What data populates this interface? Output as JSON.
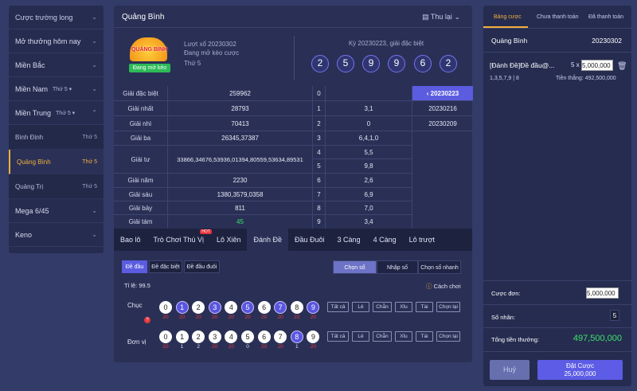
{
  "sidebar": {
    "items": [
      {
        "label": "Cược trường long"
      },
      {
        "label": "Mở thưởng hôm nay"
      },
      {
        "label": "Miền Bắc"
      },
      {
        "label": "Miền Nam",
        "day": "Thứ 5"
      },
      {
        "label": "Miền Trung",
        "day": "Thứ 5"
      }
    ],
    "sub_items": [
      {
        "label": "Bình Định",
        "day": "Thứ 5"
      },
      {
        "label": "Quảng Bình",
        "day": "Thứ 5"
      },
      {
        "label": "Quảng Trị",
        "day": "Thứ 5"
      }
    ],
    "bottom": [
      {
        "label": "Mega 6/45"
      },
      {
        "label": "Keno"
      }
    ]
  },
  "main": {
    "title": "Quảng Bình",
    "thu_lai": "Thu lại",
    "logo_name": "QUẢNG BÌNH",
    "logo_badge": "Đang mở kèo",
    "luot_xo": "Lượt xổ 20230302",
    "dang_mo": "Đang mở kèo cược",
    "thu": "Thứ 5",
    "ky": "Kỳ 20230223, giải đặc biệt",
    "balls": [
      "2",
      "5",
      "9",
      "9",
      "6",
      "2"
    ]
  },
  "results": [
    {
      "name": "Giải đặc biệt",
      "value": "259962"
    },
    {
      "name": "Giải nhất",
      "value": "28793"
    },
    {
      "name": "Giải nhì",
      "value": "70413"
    },
    {
      "name": "Giải ba",
      "value": "26345,37387"
    },
    {
      "name": "Giải tư",
      "value": "33866,34676,53936,01394,80559,53634,89531"
    },
    {
      "name": "Giải năm",
      "value": "2230"
    },
    {
      "name": "Giải sáu",
      "value": "1380,3579,0358"
    },
    {
      "name": "Giải bảy",
      "value": "811"
    },
    {
      "name": "Giải tám",
      "value": "45"
    }
  ],
  "dauduoi": [
    {
      "h": "0",
      "v": ""
    },
    {
      "h": "1",
      "v": "3,1"
    },
    {
      "h": "2",
      "v": "0"
    },
    {
      "h": "3",
      "v": "6,4,1,0"
    },
    {
      "h": "4",
      "v": "5,5"
    },
    {
      "h": "5",
      "v": "9,8"
    },
    {
      "h": "6",
      "v": "2,6"
    },
    {
      "h": "7",
      "v": "6,9"
    },
    {
      "h": "8",
      "v": "7,0"
    },
    {
      "h": "9",
      "v": "3,4"
    }
  ],
  "dates": [
    "20230223",
    "20230216",
    "20230209"
  ],
  "tabs": [
    {
      "label": "Bao lô"
    },
    {
      "label": "Trò Chơi Thú Vị",
      "hot": "HOT"
    },
    {
      "label": "Lô Xiên"
    },
    {
      "label": "Đánh Đề"
    },
    {
      "label": "Đầu Đuôi"
    },
    {
      "label": "3 Càng"
    },
    {
      "label": "4 Càng"
    },
    {
      "label": "Lô trượt"
    }
  ],
  "bet_types": [
    "Đề đầu",
    "Đề đặc biệt",
    "Đề đầu đuôi"
  ],
  "modes": [
    "Chọn số",
    "Nhập số",
    "Chọn số nhanh"
  ],
  "ti_le": "Tỉ lệ:  99.5",
  "cach_choi": "Cách chơi",
  "chuc": {
    "label": "Chục",
    "numbers": [
      "0",
      "1",
      "2",
      "3",
      "4",
      "5",
      "6",
      "7",
      "8",
      "9"
    ],
    "counts": [
      "20",
      "20",
      "20",
      "20",
      "20",
      "20",
      "20",
      "20",
      "20",
      "20"
    ]
  },
  "don_vi": {
    "label": "Đơn vị",
    "numbers": [
      "0",
      "1",
      "2",
      "3",
      "4",
      "5",
      "6",
      "7",
      "8",
      "9"
    ],
    "counts": [
      "20",
      "1",
      "2",
      "20",
      "20",
      "0",
      "20",
      "20",
      "1",
      "20"
    ]
  },
  "filters": [
    "Tất cả",
    "Lẻ",
    "Chẵn",
    "Xỉu",
    "Tài",
    "Chọn lại"
  ],
  "right": {
    "tabs": [
      "Bảng cược",
      "Chưa thanh toán",
      "Đã thanh toán"
    ],
    "province": "Quảng Bình",
    "draw": "20230302",
    "bet_title": "[Đánh Đề]Đề đầu@...",
    "mult": "5 x",
    "amount": "5,000,000",
    "bet_nums": "1,3,5,7,9 | 8",
    "tien_thang": "Tiền thắng: 492,500,000",
    "cuoc_don_label": "Cược đơn:",
    "cuoc_don": "5,000,000",
    "so_nhan_label": "Số nhân:",
    "so_nhan": "5",
    "tong_label": "Tổng tiền thưởng:",
    "tong": "497,500,000",
    "huy": "Huỷ",
    "dat_cuoc": "Đặt Cược",
    "dat_amount": "25,000,000"
  },
  "colors": {
    "accent": "#5b5ce0",
    "gold": "#f4b03c",
    "green": "#3be36a",
    "red": "#e5383e"
  }
}
